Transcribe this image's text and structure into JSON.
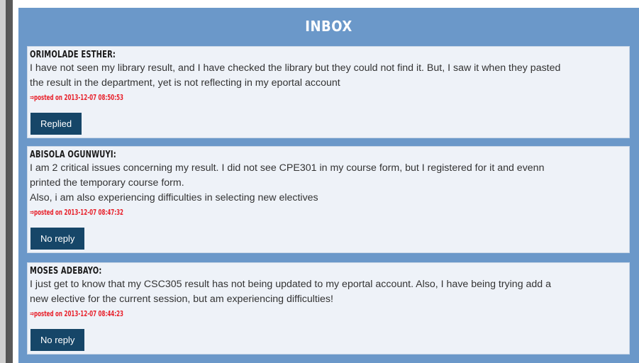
{
  "inbox": {
    "title": "INBOX",
    "messages": [
      {
        "sender": "ORIMOLADE ESTHER:",
        "lines": [
          "I have not seen my library result, and I have checked the library but they could not find it. But, I saw it when they pasted",
          "the result in the department, yet is not reflecting in my eportal account"
        ],
        "posted_prefix": "posted on",
        "posted_at": "2013-12-07 08:50:53",
        "status_label": "Replied"
      },
      {
        "sender": "ABISOLA OGUNWUYI:",
        "lines": [
          "I am 2 critical issues concerning my result. I did not see CPE301 in my course form, but I registered for it and evenn",
          "printed the temporary course form.",
          "Also, i am also experiencing difficulties in selecting new electives"
        ],
        "posted_prefix": "posted on",
        "posted_at": "2013-12-07 08:47:32",
        "status_label": "No reply"
      },
      {
        "sender": "MOSES ADEBAYO:",
        "lines": [
          "I just get to know that my CSC305 result has not being updated to my eportal account. Also, I have being trying add a",
          "new elective for the current session, but am experiencing difficulties!"
        ],
        "posted_prefix": "posted on",
        "posted_at": "2013-12-07 08:44:23",
        "status_label": "No reply"
      }
    ]
  },
  "colors": {
    "panel": "#6b98c9",
    "card": "#eef2f8",
    "button": "#164668",
    "timestamp": "#e8202a"
  },
  "icons": {
    "posted_arrow": "double-right-arrow-icon"
  }
}
